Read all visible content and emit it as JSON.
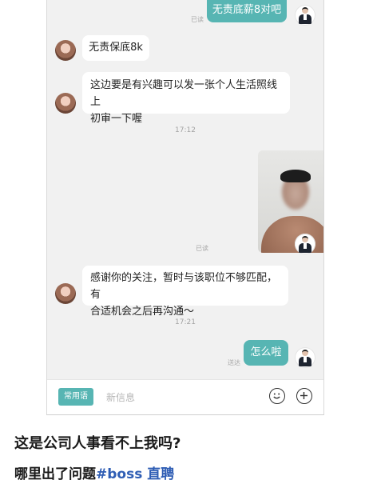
{
  "chat": {
    "messages": [
      {
        "side": "right",
        "text": "无责底薪8对吧",
        "status": "已读"
      },
      {
        "side": "left",
        "text": "无责保底8k"
      },
      {
        "side": "left",
        "lines": [
          "这边要是有兴趣可以发一张个人生活照线上",
          "初审一下喔"
        ]
      },
      {
        "time": "17:12"
      },
      {
        "side": "right",
        "type": "image",
        "status": "已读"
      },
      {
        "side": "left",
        "lines": [
          "感谢你的关注，暂时与该职位不够匹配，有",
          "合适机会之后再沟通～"
        ]
      },
      {
        "time": "17:21"
      },
      {
        "side": "right",
        "text": "怎么啦",
        "status": "送达"
      }
    ]
  },
  "input_bar": {
    "phrase_button": "常用语",
    "placeholder": "新信息",
    "emoji_icon": "smiley-icon",
    "plus_icon": "plus-icon"
  },
  "caption": {
    "line1": "这是公司人事看不上我吗?",
    "line2_prefix": "哪里出了问题",
    "hashtag": "#boss 直聘"
  },
  "colors": {
    "accent": "#57b5b3",
    "hashtag": "#2e5db4",
    "background": "#f1f1f1"
  }
}
